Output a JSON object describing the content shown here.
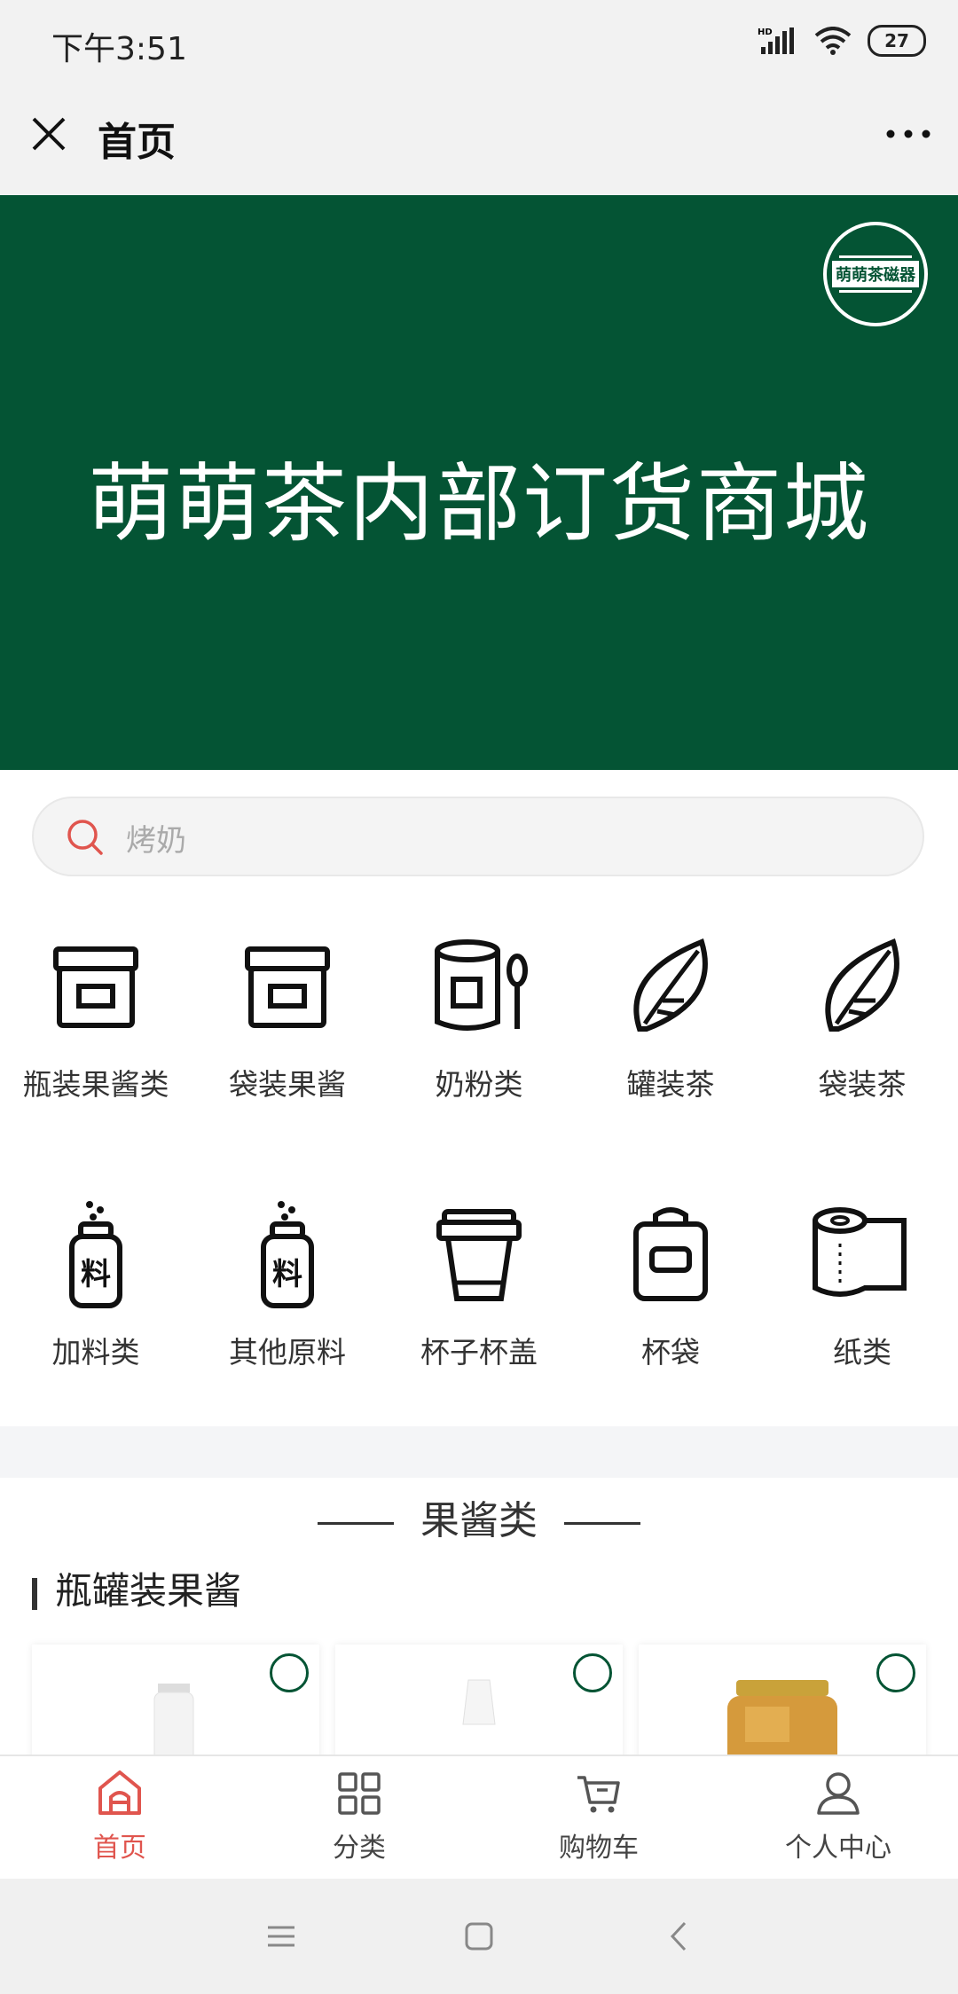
{
  "status": {
    "time": "下午3:51",
    "battery": "27"
  },
  "header": {
    "title": "首页"
  },
  "banner": {
    "title": "萌萌茶内部订货商城",
    "logo_text": "萌萌茶磁器"
  },
  "search": {
    "placeholder": "烤奶"
  },
  "categories": [
    {
      "label": "瓶装果酱类",
      "icon": "jar-icon"
    },
    {
      "label": "袋装果酱",
      "icon": "jar-icon"
    },
    {
      "label": "奶粉类",
      "icon": "milk-powder-can-icon"
    },
    {
      "label": "罐装茶",
      "icon": "leaf-icon"
    },
    {
      "label": "袋装茶",
      "icon": "leaf-icon"
    },
    {
      "label": "加料类",
      "icon": "ingredient-bottle-icon"
    },
    {
      "label": "其他原料",
      "icon": "ingredient-bottle-icon"
    },
    {
      "label": "杯子杯盖",
      "icon": "cup-icon"
    },
    {
      "label": "杯袋",
      "icon": "bag-icon"
    },
    {
      "label": "纸类",
      "icon": "paper-roll-icon"
    }
  ],
  "section": {
    "title": "果酱类",
    "subtitle": "瓶罐装果酱"
  },
  "tabs": [
    {
      "label": "首页",
      "icon": "home-icon",
      "active": true
    },
    {
      "label": "分类",
      "icon": "grid-icon",
      "active": false
    },
    {
      "label": "购物车",
      "icon": "cart-icon",
      "active": false
    },
    {
      "label": "个人中心",
      "icon": "user-icon",
      "active": false
    }
  ],
  "colors": {
    "brand_green": "#045434",
    "accent_red": "#e0554e"
  }
}
